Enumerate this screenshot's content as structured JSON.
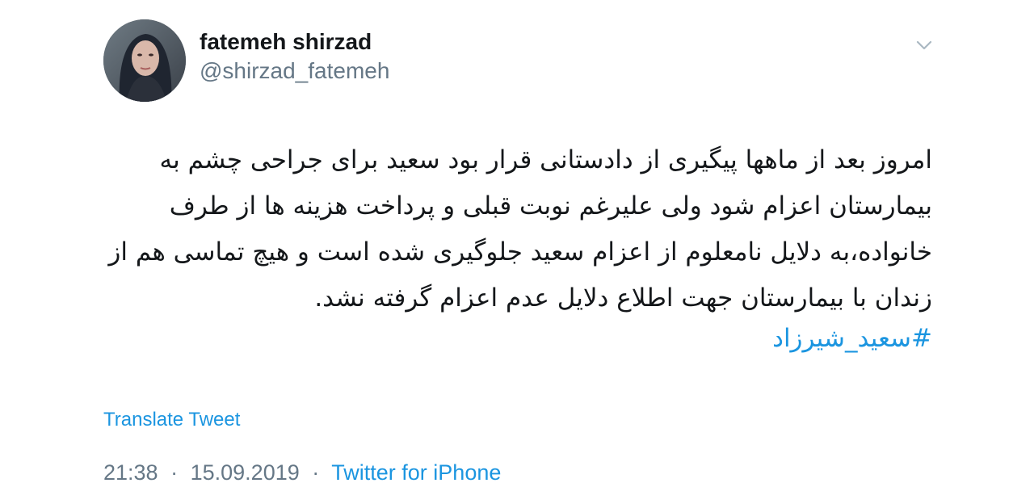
{
  "user": {
    "name": "fatemeh shirzad",
    "handle": "@shirzad_fatemeh",
    "avatar_icon": "profile-photo"
  },
  "menu": {
    "icon": "chevron-down-icon"
  },
  "tweet": {
    "text": "امروز بعد از ماهها پیگیری از دادستانی قرار بود سعید برای جراحی چشم به بیمارستان اعزام شود ولی علیرغم نوبت قبلی و پرداخت هزینه ها از طرف خانواده،به دلایل نامعلوم از اعزام سعید جلوگیری شده است و هیچ تماسی هم از زندان با بیمارستان جهت اطلاع دلایل عدم اعزام گرفته نشد.",
    "hashtag": "#سعید_شیرزاد",
    "translate_label": "Translate Tweet",
    "time": "21:38",
    "date": "15.09.2019",
    "separator": "·",
    "source": "Twitter for iPhone"
  },
  "colors": {
    "link": "#1b95e0",
    "secondary": "#657786",
    "primary": "#14171a"
  }
}
